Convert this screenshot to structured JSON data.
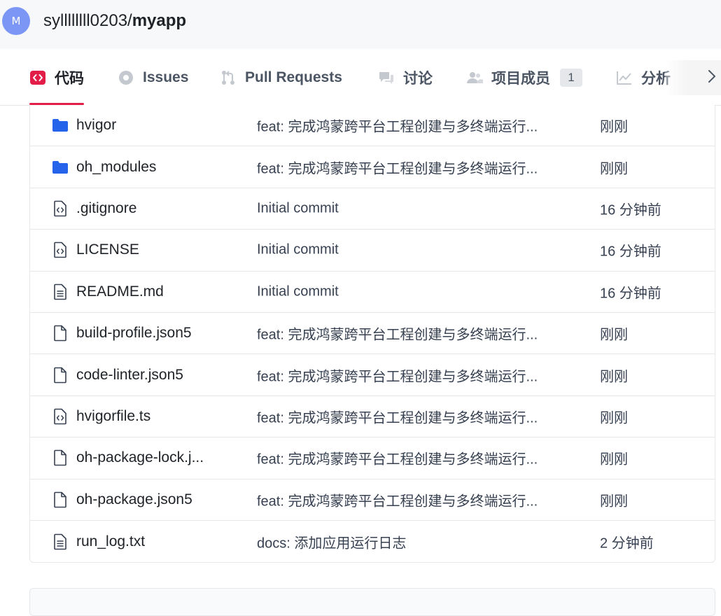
{
  "header": {
    "avatar_letter": "M",
    "owner": "syllllllll0203",
    "separator": "/",
    "repo": "myapp"
  },
  "tabs": [
    {
      "label": "代码",
      "icon": "code-icon",
      "active": true
    },
    {
      "label": "Issues",
      "icon": "issues-icon",
      "active": false
    },
    {
      "label": "Pull Requests",
      "icon": "pull-request-icon",
      "active": false
    },
    {
      "label": "讨论",
      "icon": "discussion-icon",
      "active": false
    },
    {
      "label": "项目成员",
      "icon": "members-icon",
      "active": false,
      "count": "1"
    },
    {
      "label": "分析",
      "icon": "analytics-icon",
      "active": false
    }
  ],
  "files": [
    {
      "name": "hvigor",
      "type": "folder",
      "icon": "folder-icon",
      "message": "feat: 完成鸿蒙跨平台工程创建与多终端运行...",
      "time": "刚刚"
    },
    {
      "name": "oh_modules",
      "type": "folder",
      "icon": "folder-icon",
      "message": "feat: 完成鸿蒙跨平台工程创建与多终端运行...",
      "time": "刚刚"
    },
    {
      "name": ".gitignore",
      "type": "code",
      "icon": "code-file-icon",
      "message": "Initial commit",
      "time": "16 分钟前"
    },
    {
      "name": "LICENSE",
      "type": "code",
      "icon": "code-file-icon",
      "message": "Initial commit",
      "time": "16 分钟前"
    },
    {
      "name": "README.md",
      "type": "text",
      "icon": "text-file-icon",
      "message": "Initial commit",
      "time": "16 分钟前"
    },
    {
      "name": "build-profile.json5",
      "type": "file",
      "icon": "file-icon",
      "message": "feat: 完成鸿蒙跨平台工程创建与多终端运行...",
      "time": "刚刚"
    },
    {
      "name": "code-linter.json5",
      "type": "file",
      "icon": "file-icon",
      "message": "feat: 完成鸿蒙跨平台工程创建与多终端运行...",
      "time": "刚刚"
    },
    {
      "name": "hvigorfile.ts",
      "type": "code",
      "icon": "code-file-icon",
      "message": "feat: 完成鸿蒙跨平台工程创建与多终端运行...",
      "time": "刚刚"
    },
    {
      "name": "oh-package-lock.j...",
      "type": "file",
      "icon": "file-icon",
      "message": "feat: 完成鸿蒙跨平台工程创建与多终端运行...",
      "time": "刚刚"
    },
    {
      "name": "oh-package.json5",
      "type": "file",
      "icon": "file-icon",
      "message": "feat: 完成鸿蒙跨平台工程创建与多终端运行...",
      "time": "刚刚"
    },
    {
      "name": "run_log.txt",
      "type": "text",
      "icon": "text-file-icon",
      "message": "docs: 添加应用运行日志",
      "time": "2 分钟前"
    }
  ],
  "colors": {
    "accent": "#e11d48",
    "folder": "#2563eb",
    "avatar": "#7b96f5"
  }
}
